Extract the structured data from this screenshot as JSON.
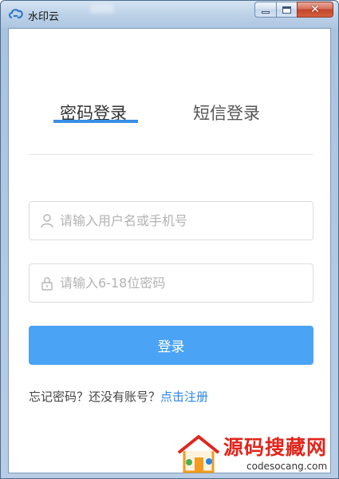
{
  "window": {
    "title": "水印云",
    "controls": {
      "minimize": "minimize",
      "maximize": "maximize",
      "close": "✕"
    }
  },
  "tabs": [
    {
      "label": "密码登录",
      "active": true
    },
    {
      "label": "短信登录",
      "active": false
    }
  ],
  "form": {
    "username_placeholder": "请输入用户名或手机号",
    "password_placeholder": "请输入6-18位密码",
    "login_label": "登录"
  },
  "links": {
    "forgot_password": "忘记密码？",
    "no_account": "还没有账号？",
    "register": "点击注册"
  },
  "watermark": {
    "site_name": "源码搜藏网",
    "url": "codesocang.com"
  },
  "colors": {
    "accent": "#3a8ee6",
    "button": "#4aa3f5",
    "link": "#2a86e4",
    "watermark": "#e0261c"
  }
}
